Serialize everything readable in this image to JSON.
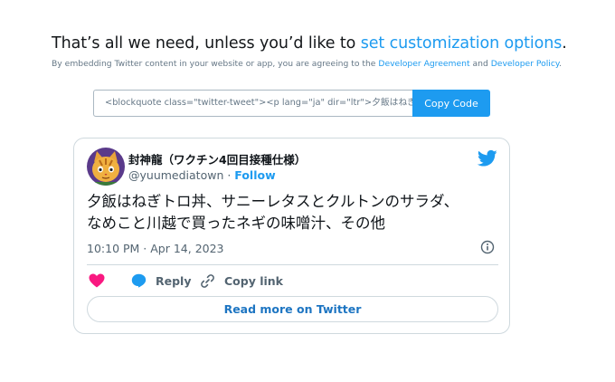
{
  "header": {
    "headline_prefix": "That’s all we need, unless you’d like to ",
    "headline_link": "set customization options",
    "headline_suffix": ".",
    "sub_prefix": "By embedding Twitter content in your website or app, you are agreeing to the ",
    "sub_link_1": "Developer Agreement",
    "sub_middle": " and ",
    "sub_link_2": "Developer Policy",
    "sub_suffix": "."
  },
  "embed": {
    "code": "<blockquote class=\"twitter-tweet\"><p lang=\"ja\" dir=\"ltr\">夕飯はねぎトロ丼、サニーレタスとクルトンのサラダ、なめこと川越で買ったネギの味噌汁、その他</p>",
    "copy_label": "Copy Code"
  },
  "tweet": {
    "display_name": "封神龍（ワクチン4回目接種仕様）",
    "handle": "@yuumediatown",
    "separator": " · ",
    "follow_label": "Follow",
    "text_line_1": "夕飯はねぎトロ丼、サニーレタスとクルトンのサラダ、",
    "text_line_2": "なめこと川越で買ったネギの味噌汁、その他",
    "timestamp": "10:10 PM · Apr 14, 2023",
    "reply_label": "Reply",
    "copy_link_label": "Copy link",
    "read_more_label": "Read more on Twitter"
  },
  "colors": {
    "accent": "#1d9bf0",
    "like": "#f91880",
    "text_secondary": "#536471",
    "border": "#cfd9de"
  },
  "icons": [
    "twitter-bird-icon",
    "info-icon",
    "heart-icon",
    "reply-icon",
    "link-icon",
    "cat-avatar"
  ]
}
